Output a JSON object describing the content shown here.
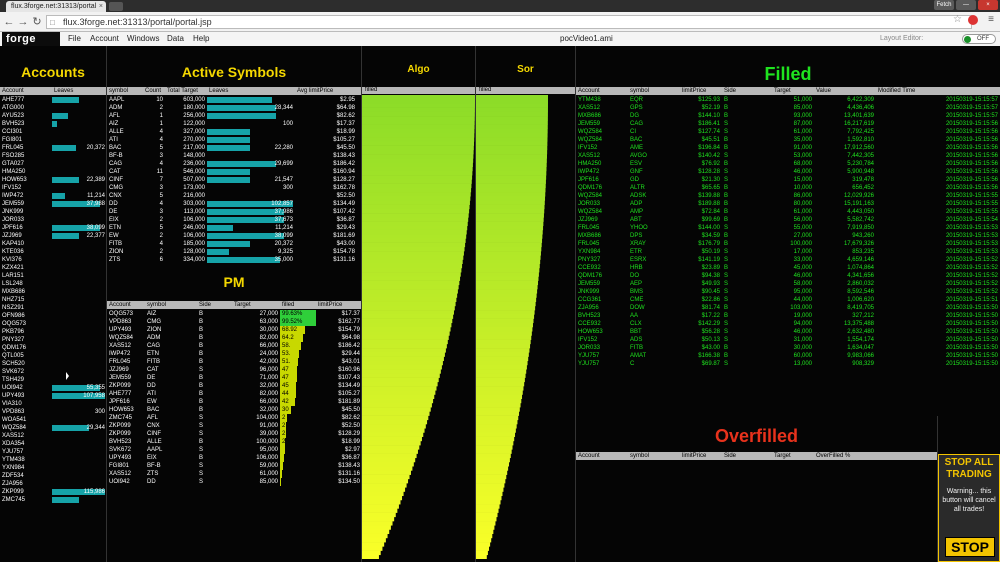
{
  "browser": {
    "tab_title": "flux.3forge.net:31313/portal",
    "url": "flux.3forge.net:31313/portal/portal.jsp",
    "window_buttons": [
      "Fetch",
      "—",
      "×"
    ]
  },
  "app": {
    "logo": "forge",
    "menu": [
      "File",
      "Account",
      "Windows",
      "Data",
      "Help"
    ],
    "title": "pocVideo1.ami",
    "layout_label": "Layout Editor:",
    "toggle_label": "OFF"
  },
  "accounts": {
    "title": "Accounts",
    "columns": [
      "Account",
      "Leaves"
    ],
    "rows": [
      {
        "a": "AHE777",
        "v": "",
        "f": 0.5
      },
      {
        "a": "ATG000",
        "v": "",
        "f": 0.0
      },
      {
        "a": "AYU523",
        "v": "",
        "f": 0.3
      },
      {
        "a": "BVH523",
        "v": "",
        "f": 0.1
      },
      {
        "a": "CCI301",
        "v": "",
        "f": 0.0
      },
      {
        "a": "FGI801",
        "v": "",
        "f": 0.0
      },
      {
        "a": "FRL045",
        "v": "20,372",
        "f": 0.45
      },
      {
        "a": "FSO285",
        "v": "",
        "f": 0.0
      },
      {
        "a": "GTA027",
        "v": "",
        "f": 0.0
      },
      {
        "a": "HMA250",
        "v": "",
        "f": 0.0
      },
      {
        "a": "HOW653",
        "v": "22,389",
        "f": 0.5
      },
      {
        "a": "IFV152",
        "v": "",
        "f": 0.0
      },
      {
        "a": "IWP472",
        "v": "11,214",
        "f": 0.25
      },
      {
        "a": "JEM559",
        "v": "37,988",
        "f": 0.9
      },
      {
        "a": "JNK999",
        "v": "",
        "f": 0.0
      },
      {
        "a": "JOR033",
        "v": "",
        "f": 0.0
      },
      {
        "a": "JPF616",
        "v": "38,099",
        "f": 0.9
      },
      {
        "a": "JZJ969",
        "v": "22,377",
        "f": 0.5
      },
      {
        "a": "KAP410",
        "v": "",
        "f": 0.0
      },
      {
        "a": "KTE036",
        "v": "",
        "f": 0.0
      },
      {
        "a": "KVI376",
        "v": "",
        "f": 0.0
      },
      {
        "a": "KZX421",
        "v": "",
        "f": 0.0
      },
      {
        "a": "LAR151",
        "v": "",
        "f": 0.0
      },
      {
        "a": "LSL248",
        "v": "",
        "f": 0.0
      },
      {
        "a": "MXB686",
        "v": "",
        "f": 0.0
      },
      {
        "a": "NHZ715",
        "v": "",
        "f": 0.0
      },
      {
        "a": "NSZ291",
        "v": "",
        "f": 0.0
      },
      {
        "a": "OFN986",
        "v": "",
        "f": 0.0
      },
      {
        "a": "OQG573",
        "v": "",
        "f": 0.0
      },
      {
        "a": "PKB796",
        "v": "",
        "f": 0.0
      },
      {
        "a": "PNY327",
        "v": "",
        "f": 0.0
      },
      {
        "a": "QDM176",
        "v": "",
        "f": 0.0
      },
      {
        "a": "QTL005",
        "v": "",
        "f": 0.0
      },
      {
        "a": "SCH520",
        "v": "",
        "f": 0.0
      },
      {
        "a": "SVK672",
        "v": "",
        "f": 0.0
      },
      {
        "a": "TSH429",
        "v": "",
        "f": 0.0
      },
      {
        "a": "UOI942",
        "v": "55,355",
        "f": 0.9
      },
      {
        "a": "UPY493",
        "v": "107,958",
        "f": 1.0
      },
      {
        "a": "VIA310",
        "v": "",
        "f": 0.0
      },
      {
        "a": "VPD863",
        "v": "300",
        "f": 0.0
      },
      {
        "a": "WOA541",
        "v": "",
        "f": 0.0
      },
      {
        "a": "WQZ584",
        "v": "29,344",
        "f": 0.7
      },
      {
        "a": "XAS512",
        "v": "",
        "f": 0.0
      },
      {
        "a": "XDA354",
        "v": "",
        "f": 0.0
      },
      {
        "a": "YJU757",
        "v": "",
        "f": 0.0
      },
      {
        "a": "YTM438",
        "v": "",
        "f": 0.0
      },
      {
        "a": "YXN984",
        "v": "",
        "f": 0.0
      },
      {
        "a": "ZDF534",
        "v": "",
        "f": 0.0
      },
      {
        "a": "ZJA956",
        "v": "",
        "f": 0.0
      },
      {
        "a": "ZKP099",
        "v": "115,986",
        "f": 1.0
      },
      {
        "a": "ZMC745",
        "v": "",
        "f": 0.5
      }
    ]
  },
  "active_symbols": {
    "title": "Active Symbols",
    "columns": [
      "symbol",
      "Count",
      "Total Target",
      "Leaves",
      "Avg limitPrice"
    ],
    "rows": [
      {
        "s": "AAPL",
        "c": "10",
        "t": "603,000",
        "l": "",
        "lf": 0.75,
        "p": "$2.95"
      },
      {
        "s": "ADM",
        "c": "2",
        "t": "180,000",
        "l": "28,344",
        "lf": 0.8,
        "p": "$64.98"
      },
      {
        "s": "AFL",
        "c": "1",
        "t": "256,000",
        "l": "",
        "lf": 0.8,
        "p": "$82.62"
      },
      {
        "s": "AIZ",
        "c": "1",
        "t": "122,000",
        "l": "100",
        "lf": 0.0,
        "p": "$17.37"
      },
      {
        "s": "ALLE",
        "c": "4",
        "t": "327,000",
        "l": "",
        "lf": 0.5,
        "p": "$18.99"
      },
      {
        "s": "ATI",
        "c": "4",
        "t": "270,000",
        "l": "",
        "lf": 0.5,
        "p": "$105.27"
      },
      {
        "s": "BAC",
        "c": "5",
        "t": "217,000",
        "l": "22,280",
        "lf": 0.5,
        "p": "$45.50"
      },
      {
        "s": "BF-B",
        "c": "3",
        "t": "148,000",
        "l": "",
        "lf": 0.0,
        "p": "$138.43"
      },
      {
        "s": "CAG",
        "c": "4",
        "t": "236,000",
        "l": "29,699",
        "lf": 0.8,
        "p": "$186.42"
      },
      {
        "s": "CAT",
        "c": "11",
        "t": "546,000",
        "l": "",
        "lf": 0.5,
        "p": "$160.94"
      },
      {
        "s": "CINF",
        "c": "7",
        "t": "507,000",
        "l": "21,547",
        "lf": 0.5,
        "p": "$128.27"
      },
      {
        "s": "CMG",
        "c": "3",
        "t": "173,000",
        "l": "300",
        "lf": 0.0,
        "p": "$162.78"
      },
      {
        "s": "CNX",
        "c": "5",
        "t": "216,000",
        "l": "",
        "lf": 0.0,
        "p": "$52.50"
      },
      {
        "s": "DD",
        "c": "4",
        "t": "303,000",
        "l": "102,857",
        "lf": 1.0,
        "p": "$134.49"
      },
      {
        "s": "DE",
        "c": "3",
        "t": "113,000",
        "l": "37,986",
        "lf": 0.9,
        "p": "$107.42"
      },
      {
        "s": "EIX",
        "c": "2",
        "t": "106,000",
        "l": "37,673",
        "lf": 0.9,
        "p": "$36.87"
      },
      {
        "s": "ETN",
        "c": "5",
        "t": "246,000",
        "l": "11,214",
        "lf": 0.3,
        "p": "$29.43"
      },
      {
        "s": "EW",
        "c": "2",
        "t": "106,000",
        "l": "38,099",
        "lf": 0.9,
        "p": "$181.69"
      },
      {
        "s": "FITB",
        "c": "4",
        "t": "185,000",
        "l": "20,372",
        "lf": 0.5,
        "p": "$43.00"
      },
      {
        "s": "ZION",
        "c": "2",
        "t": "128,000",
        "l": "9,325",
        "lf": 0.25,
        "p": "$154.78"
      },
      {
        "s": "ZTS",
        "c": "6",
        "t": "334,000",
        "l": "35,000",
        "lf": 0.85,
        "p": "$131.16"
      }
    ]
  },
  "pm": {
    "title": "PM",
    "columns": [
      "Account",
      "symbol",
      "Side",
      "Target",
      "filled",
      "limitPrice"
    ],
    "rows": [
      {
        "a": "OQG573",
        "s": "AIZ",
        "d": "B",
        "t": "27,000",
        "f": "99.63%",
        "ff": 0.9963,
        "p": "$17.37"
      },
      {
        "a": "VPD863",
        "s": "CMG",
        "d": "B",
        "t": "63,000",
        "f": "99.52%",
        "ff": 0.9952,
        "p": "$162.77"
      },
      {
        "a": "UPY493",
        "s": "ZION",
        "d": "B",
        "t": "30,000",
        "f": "68.92",
        "ff": 0.6892,
        "p": "$154.79"
      },
      {
        "a": "WQZ584",
        "s": "ADM",
        "d": "B",
        "t": "82,000",
        "f": "64.2",
        "ff": 0.642,
        "p": "$64.98"
      },
      {
        "a": "XAS512",
        "s": "CAG",
        "d": "B",
        "t": "66,000",
        "f": "58.",
        "ff": 0.58,
        "p": "$186.42"
      },
      {
        "a": "IWP472",
        "s": "ETN",
        "d": "B",
        "t": "24,000",
        "f": "53.",
        "ff": 0.53,
        "p": "$29.44"
      },
      {
        "a": "FRL045",
        "s": "FITB",
        "d": "B",
        "t": "42,000",
        "f": "51.",
        "ff": 0.51,
        "p": "$43.01"
      },
      {
        "a": "JZJ969",
        "s": "CAT",
        "d": "S",
        "t": "96,000",
        "f": "47",
        "ff": 0.47,
        "p": "$160.96"
      },
      {
        "a": "JEM559",
        "s": "DE",
        "d": "B",
        "t": "71,000",
        "f": "47",
        "ff": 0.47,
        "p": "$107.43"
      },
      {
        "a": "ZKP099",
        "s": "DD",
        "d": "B",
        "t": "32,000",
        "f": "45",
        "ff": 0.45,
        "p": "$134.49"
      },
      {
        "a": "AHE777",
        "s": "ATI",
        "d": "B",
        "t": "82,000",
        "f": "44",
        "ff": 0.44,
        "p": "$105.27"
      },
      {
        "a": "JPF616",
        "s": "EW",
        "d": "B",
        "t": "66,000",
        "f": "42",
        "ff": 0.42,
        "p": "$181.89"
      },
      {
        "a": "HOW653",
        "s": "BAC",
        "d": "B",
        "t": "32,000",
        "f": "30",
        "ff": 0.3,
        "p": "$45.50"
      },
      {
        "a": "ZMC745",
        "s": "AFL",
        "d": "S",
        "t": "104,000",
        "f": "2",
        "ff": 0.2,
        "p": "$82.62"
      },
      {
        "a": "ZKP099",
        "s": "CNX",
        "d": "S",
        "t": "91,000",
        "f": "2",
        "ff": 0.18,
        "p": "$52.50"
      },
      {
        "a": "ZKP099",
        "s": "CINF",
        "d": "S",
        "t": "39,000",
        "f": "2",
        "ff": 0.17,
        "p": "$128.29"
      },
      {
        "a": "BVH523",
        "s": "ALLE",
        "d": "B",
        "t": "100,000",
        "f": "2",
        "ff": 0.15,
        "p": "$18.99"
      },
      {
        "a": "SVK672",
        "s": "AAPL",
        "d": "S",
        "t": "95,000",
        "f": "",
        "ff": 0.13,
        "p": "$2.97"
      },
      {
        "a": "UPY493",
        "s": "EIX",
        "d": "B",
        "t": "106,000",
        "f": "",
        "ff": 0.1,
        "p": "$36.87"
      },
      {
        "a": "FGI801",
        "s": "BF-B",
        "d": "S",
        "t": "59,000",
        "f": "",
        "ff": 0.08,
        "p": "$138.43"
      },
      {
        "a": "XAS512",
        "s": "ZTS",
        "d": "S",
        "t": "61,000",
        "f": "",
        "ff": 0.06,
        "p": "$131.16"
      },
      {
        "a": "UOI942",
        "s": "DD",
        "d": "S",
        "t": "85,000",
        "f": "",
        "ff": 0.04,
        "p": "$134.50"
      }
    ]
  },
  "algo": {
    "title": "Algo",
    "column": "filled",
    "bar_count": 110
  },
  "sor": {
    "title": "Sor",
    "column": "filled",
    "bar_count": 110
  },
  "filled": {
    "title": "Filled",
    "columns": [
      "Account",
      "symbol",
      "limitPrice",
      "Side",
      "Target",
      "Value",
      "Modified Time"
    ],
    "rows": [
      [
        "YTM438",
        "EQR",
        "$125.93",
        "B",
        "51,000",
        "6,422,309",
        "20150319-15:15:57"
      ],
      [
        "XAS512",
        "GPS",
        "$52.19",
        "B",
        "85,000",
        "4,436,406",
        "20150319-15:15:57"
      ],
      [
        "MXB686",
        "DG",
        "$144.10",
        "B",
        "93,000",
        "13,401,639",
        "20150319-15:15:57"
      ],
      [
        "JEM559",
        "CAG",
        "$186.41",
        "S",
        "87,000",
        "16,217,619",
        "20150319-15:15:56"
      ],
      [
        "WQZ584",
        "CI",
        "$127.74",
        "S",
        "61,000",
        "7,792,425",
        "20150319-15:15:56"
      ],
      [
        "WQZ584",
        "BAC",
        "$45.51",
        "B",
        "35,000",
        "1,592,810",
        "20150319-15:15:56"
      ],
      [
        "IFV152",
        "AME",
        "$196.84",
        "B",
        "91,000",
        "17,912,560",
        "20150319-15:15:56"
      ],
      [
        "XAS512",
        "AVGO",
        "$140.42",
        "S",
        "53,000",
        "7,442,305",
        "20150319-15:15:56"
      ],
      [
        "HMA250",
        "ESV",
        "$76.92",
        "B",
        "68,000",
        "5,230,784",
        "20150319-15:15:56"
      ],
      [
        "IWP472",
        "GNF",
        "$128.28",
        "S",
        "46,000",
        "5,900,948",
        "20150319-15:15:56"
      ],
      [
        "JPF616",
        "GD",
        "$21.30",
        "S",
        "15,000",
        "319,478",
        "20150319-15:15:56"
      ],
      [
        "QDM176",
        "ALTR",
        "$65.65",
        "B",
        "10,000",
        "656,452",
        "20150319-15:15:56"
      ],
      [
        "WQZ584",
        "ADSK",
        "$139.88",
        "B",
        "86,000",
        "12,029,926",
        "20150319-15:15:55"
      ],
      [
        "JOR033",
        "ADP",
        "$189.88",
        "B",
        "80,000",
        "15,191,163",
        "20150319-15:15:55"
      ],
      [
        "WQZ584",
        "AMP",
        "$72.84",
        "B",
        "61,000",
        "4,443,050",
        "20150319-15:15:55"
      ],
      [
        "JZJ969",
        "ABT",
        "$99.69",
        "B",
        "56,000",
        "5,582,742",
        "20150319-15:15:54"
      ],
      [
        "FRL045",
        "YHOO",
        "$144.00",
        "S",
        "55,000",
        "7,919,850",
        "20150319-15:15:53"
      ],
      [
        "MXB686",
        "DPS",
        "$34.59",
        "B",
        "27,000",
        "943,260",
        "20150319-15:15:53"
      ],
      [
        "FRL045",
        "XRAY",
        "$176.79",
        "B",
        "100,000",
        "17,679,326",
        "20150319-15:15:53"
      ],
      [
        "YXN984",
        "ETR",
        "$50.19",
        "S",
        "17,000",
        "853,235",
        "20150319-15:15:53"
      ],
      [
        "PNY327",
        "ESRX",
        "$141.19",
        "S",
        "33,000",
        "4,659,146",
        "20150319-15:15:52"
      ],
      [
        "CCE932",
        "HRB",
        "$23.89",
        "B",
        "45,000",
        "1,074,864",
        "20150319-15:15:52"
      ],
      [
        "QDM176",
        "DO",
        "$94.38",
        "S",
        "46,000",
        "4,341,656",
        "20150319-15:15:52"
      ],
      [
        "JEM559",
        "AEP",
        "$49.93",
        "S",
        "58,000",
        "2,860,032",
        "20150319-15:15:52"
      ],
      [
        "JNK999",
        "BMS",
        "$90.45",
        "S",
        "95,000",
        "8,592,546",
        "20150319-15:15:52"
      ],
      [
        "CCG361",
        "CME",
        "$22.86",
        "S",
        "44,000",
        "1,006,620",
        "20150319-15:15:51"
      ],
      [
        "ZJA956",
        "DOW",
        "$81.74",
        "B",
        "103,000",
        "8,419,705",
        "20150319-15:15:50"
      ],
      [
        "BVH523",
        "AA",
        "$17.22",
        "B",
        "19,000",
        "327,212",
        "20150319-15:15:50"
      ],
      [
        "CCE932",
        "CLX",
        "$142.29",
        "S",
        "94,000",
        "13,375,488",
        "20150319-15:15:50"
      ],
      [
        "HOW653",
        "BBT",
        "$56.28",
        "S",
        "46,000",
        "2,632,480",
        "20150319-15:15:50"
      ],
      [
        "IFV152",
        "ADS",
        "$50.13",
        "S",
        "31,000",
        "1,554,174",
        "20150319-15:15:50"
      ],
      [
        "JOR033",
        "FITB",
        "$43.00",
        "B",
        "30,000",
        "1,634,047",
        "20150319-15:15:50"
      ],
      [
        "YJU757",
        "AMAT",
        "$166.38",
        "B",
        "60,000",
        "9,983,066",
        "20150319-15:15:50"
      ],
      [
        "YJU757",
        "C",
        "$69.87",
        "S",
        "13,000",
        "908,329",
        "20150319-15:15:50"
      ]
    ]
  },
  "overfilled": {
    "title": "Overfilled",
    "columns": [
      "Account",
      "symbol",
      "limitPrice",
      "Side",
      "Target",
      "OverFilled %"
    ]
  },
  "stop": {
    "title": "STOP ALL TRADING",
    "warning": "Warning... this button will cancel all trades!",
    "button": "STOP"
  },
  "colors": {
    "accent": "#f5d800",
    "filled_title": "#1fe31f",
    "overfilled_title": "#e8321c",
    "bar_teal": "#16a3a8"
  }
}
